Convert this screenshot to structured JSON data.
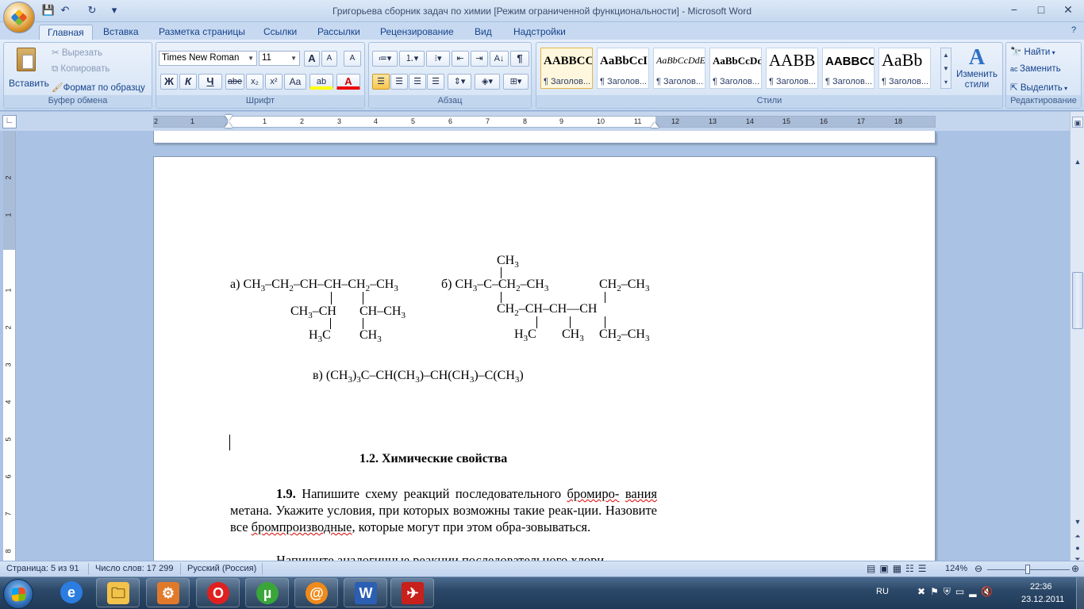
{
  "window": {
    "title": "Григорьева сборник задач по химии [Режим ограниченной функциональности] - Microsoft Word",
    "controls": {
      "minimize": "−",
      "maximize": "□",
      "close": "✕"
    }
  },
  "qat": {
    "save": "💾",
    "undo": "↶",
    "redo": "↻",
    "customize": "▾"
  },
  "tabs": [
    "Главная",
    "Вставка",
    "Разметка страницы",
    "Ссылки",
    "Рассылки",
    "Рецензирование",
    "Вид",
    "Надстройки"
  ],
  "ribbon": {
    "clipboard": {
      "paste": "Вставить",
      "cut": "Вырезать",
      "copy": "Копировать",
      "format_painter": "Формат по образцу",
      "label": "Буфер обмена"
    },
    "font": {
      "name": "Times New Roman",
      "size": "11",
      "grow": "A",
      "shrink": "A",
      "clear": "A",
      "bold": "Ж",
      "italic": "К",
      "underline": "Ч",
      "strike": "abe",
      "sub": "x₂",
      "sup": "x²",
      "case": "Aa",
      "highlight": "ab",
      "color": "A",
      "label": "Шрифт"
    },
    "paragraph": {
      "label": "Абзац",
      "pilcrow": "¶"
    },
    "styles": {
      "label": "Стили",
      "items": [
        {
          "preview": "AABBCC",
          "name": "¶ Заголов..."
        },
        {
          "preview": "AaBbCcI",
          "name": "¶ Заголов..."
        },
        {
          "preview": "AaBbCcDdE",
          "name": "¶ Заголов..."
        },
        {
          "preview": "AaBbCcDdI",
          "name": "¶ Заголов..."
        },
        {
          "preview": "AABB",
          "name": "¶ Заголов..."
        },
        {
          "preview": "AABBCC",
          "name": "¶ Заголов..."
        },
        {
          "preview": "AaBb",
          "name": "¶ Заголов..."
        }
      ],
      "change": "Изменить стили"
    },
    "editing": {
      "find": "Найти",
      "replace": "Заменить",
      "select": "Выделить",
      "label": "Редактирование"
    }
  },
  "ruler": {
    "numbers": [
      "2",
      "1",
      "1",
      "2",
      "3",
      "4",
      "5",
      "6",
      "7",
      "8",
      "9",
      "10",
      "11",
      "12",
      "13",
      "14",
      "15",
      "16",
      "17",
      "18"
    ]
  },
  "vruler": {
    "numbers": [
      "2",
      "1",
      "1",
      "2",
      "3",
      "4",
      "5",
      "6",
      "7",
      "8"
    ]
  },
  "document": {
    "formula_a": {
      "label": "а)",
      "main": [
        "CH",
        "3",
        "–CH",
        "2",
        "–CH–CH–CH",
        "2",
        "–CH",
        "3"
      ],
      "sub1": [
        "CH",
        "3",
        "–CH"
      ],
      "sub1b": [
        "H",
        "3",
        "C"
      ],
      "sub2": [
        "CH–CH",
        "3"
      ],
      "sub2b": [
        "CH",
        "3"
      ]
    },
    "formula_b": {
      "label": "б)",
      "top": [
        "CH",
        "3"
      ],
      "main": [
        "CH",
        "3",
        "–C–CH",
        "2",
        "–CH",
        "3"
      ],
      "right_top": [
        "CH",
        "2",
        "–CH",
        "3"
      ],
      "chain": [
        "CH",
        "2",
        "–CH–CH—CH"
      ],
      "bottom1": [
        "H",
        "3",
        "C"
      ],
      "bottom2": [
        "CH",
        "3"
      ],
      "bottom3": [
        "CH",
        "2",
        "–CH",
        "3"
      ]
    },
    "formula_c": {
      "text": [
        "в) (CH",
        "3",
        ")",
        "3",
        "C–CH(CH",
        "3",
        ")–CH(CH",
        "3",
        ")–C(CH",
        "3",
        ")"
      ]
    },
    "heading": "1.2. Химические свойства",
    "p1": {
      "num": "1.9.",
      "text1": " Напишите схему реакций последовательного ",
      "err1": "бромиро-",
      "err2": "вания",
      "text2": " метана. Укажите условия, при которых возможны такие реак-ции. Назовите все ",
      "err3": "бромпроизводные",
      "text3": ", которые могут при этом обра-зовываться."
    },
    "p2": "Напишите аналогичные реакции последовательного хлори-"
  },
  "status": {
    "page": "Страница: 5 из 91",
    "words": "Число слов: 17 299",
    "language": "Русский (Россия)",
    "zoom": "124%"
  },
  "taskbar": {
    "apps": [
      {
        "name": "ie-icon",
        "glyph": "e"
      },
      {
        "name": "explorer-icon",
        "glyph": "🗀"
      },
      {
        "name": "app-icon",
        "glyph": "⚙"
      },
      {
        "name": "opera-icon",
        "glyph": "O"
      },
      {
        "name": "utorrent-icon",
        "glyph": "µ"
      },
      {
        "name": "mail-icon",
        "glyph": "@"
      },
      {
        "name": "word-icon",
        "glyph": "W"
      },
      {
        "name": "acrobat-icon",
        "glyph": "✈"
      }
    ],
    "lang": "RU",
    "time": "22:36",
    "date": "23.12.2011"
  }
}
